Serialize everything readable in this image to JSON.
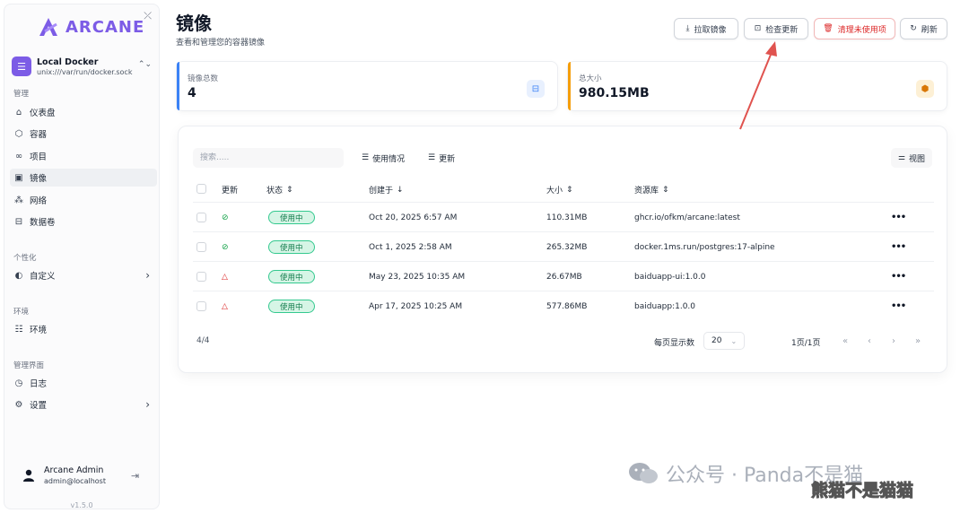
{
  "brand": {
    "name": "ARCANE",
    "accent": "#7c5ce6"
  },
  "environment": {
    "name": "Local Docker",
    "socket": "unix:///var/run/docker.sock"
  },
  "sidebar": {
    "section_manage": "管理",
    "items": [
      {
        "label": "仪表盘",
        "icon": "home-icon"
      },
      {
        "label": "容器",
        "icon": "box-icon"
      },
      {
        "label": "项目",
        "icon": "link-icon"
      },
      {
        "label": "镜像",
        "icon": "image-icon"
      },
      {
        "label": "网络",
        "icon": "network-icon"
      },
      {
        "label": "数据卷",
        "icon": "drive-icon"
      }
    ],
    "section_personal": "个性化",
    "custom": "自定义",
    "section_env": "环境",
    "env_item": "环境",
    "section_admin": "管理界面",
    "logs": "日志",
    "settings": "设置"
  },
  "user": {
    "name": "Arcane Admin",
    "email": "admin@localhost"
  },
  "version": "v1.5.0",
  "header": {
    "title": "镜像",
    "subtitle": "查看和管理您的容器镜像",
    "pull": "拉取镜像",
    "check": "检查更新",
    "prune": "清理未使用项",
    "refresh": "刷新"
  },
  "stats": {
    "total_label": "镜像总数",
    "total_value": "4",
    "size_label": "总大小",
    "size_value": "980.15MB",
    "total_color": "#3b82f6",
    "size_color": "#f59e0b"
  },
  "table": {
    "search_placeholder": "搜索.....",
    "filter_usage": "使用情况",
    "filter_update": "更新",
    "view": "视图",
    "columns": {
      "update": "更新",
      "status": "状态",
      "created": "创建于",
      "size": "大小",
      "repo": "资源库"
    },
    "rows": [
      {
        "update": "ok",
        "status": "使用中",
        "created": "Oct 20, 2025 6:57 AM",
        "size": "110.31MB",
        "repo": "ghcr.io/ofkm/arcane:latest"
      },
      {
        "update": "ok",
        "status": "使用中",
        "created": "Oct 1, 2025 2:58 AM",
        "size": "265.32MB",
        "repo": "docker.1ms.run/postgres:17-alpine"
      },
      {
        "update": "warn",
        "status": "使用中",
        "created": "May 23, 2025 10:35 AM",
        "size": "26.67MB",
        "repo": "baiduapp-ui:1.0.0"
      },
      {
        "update": "warn",
        "status": "使用中",
        "created": "Apr 17, 2025 10:25 AM",
        "size": "577.86MB",
        "repo": "baiduapp:1.0.0"
      }
    ],
    "count": "4/4",
    "per_page_label": "每页显示数",
    "per_page": "20",
    "page_info": "1页/1页"
  },
  "watermark": {
    "text": "公众号 · Panda不是猫",
    "overlay": "熊猫不是猫猫"
  }
}
